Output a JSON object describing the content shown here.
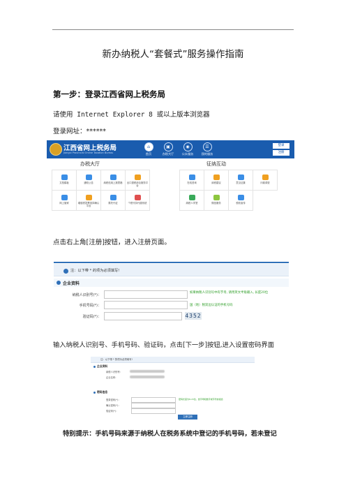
{
  "document": {
    "title": "新办纳税人“套餐式”服务操作指南",
    "step1_heading": "第一步：登录江西省网上税务局",
    "browser_note": "请使用 Internet Explorer 8 或以上版本浏览器",
    "url_label": "登录网址：******",
    "register_instruction": "点击右上角[注册]按钮，进入注册页面。",
    "input_instruction": "输入纳税人识别号、手机号码、验证码，点击[下一步]按钮,进入设置密码界面",
    "special_note": "特别提示：手机号码来源于纳税人在税务系统中登记的手机号码，若未登记"
  },
  "screenshot1": {
    "brand": "江西省网上税务局",
    "brand_sub": "Jiangxi Provincial Online Taxation Bureau",
    "nav": [
      {
        "label": "首页",
        "icon": "home-icon",
        "active": true
      },
      {
        "label": "办税大厅",
        "icon": "hall-icon",
        "active": false
      },
      {
        "label": "公众服务",
        "icon": "public-icon",
        "active": false
      },
      {
        "label": "我的服务",
        "icon": "service-icon",
        "active": false
      }
    ],
    "login_button": "登录",
    "register_button": "注册",
    "section_left": "办税大厅",
    "section_right": "征纳互动",
    "left_items": [
      {
        "label": "文档模板",
        "color": "#3a8ee6"
      },
      {
        "label": "通知公告",
        "color": "#3a8ee6"
      },
      {
        "label": "纳税信用上报表格",
        "color": "#3a8ee6"
      },
      {
        "label": "出口退税综合服务平台",
        "color": "#f0a020"
      },
      {
        "label": "网上管家",
        "color": "#3a8ee6"
      },
      {
        "label": "增值税发票选择确认平台",
        "color": "#f0a020"
      },
      {
        "label": "委托代征",
        "color": "#3a8ee6"
      },
      {
        "label": "个税代扣代缴系统",
        "color": "#e05050"
      }
    ],
    "right_items": [
      {
        "label": "在线咨询",
        "color": "#3a8ee6"
      },
      {
        "label": "纳税建议",
        "color": "#f0a020"
      },
      {
        "label": "意见征集",
        "color": "#3a8ee6"
      },
      {
        "label": "问卷调查",
        "color": "#f0a020"
      },
      {
        "label": "纳税人学堂",
        "color": "#3aaa5a"
      },
      {
        "label": "微信服务",
        "color": "#8dc63f"
      },
      {
        "label": "税收宣传",
        "color": "#3a8ee6"
      }
    ]
  },
  "screenshot2": {
    "note": "注：以下带 * 的项为必须填写!",
    "section": "企业资料",
    "fields": [
      {
        "label": "纳税人识别号(*)：",
        "hint": "如果纳税人识别号中有字母, 请用英文半角输入, 长度20位"
      },
      {
        "label": "手机号码(*)：",
        "hint": "国（地）税双边认证的手机号码"
      },
      {
        "label": "验证码(*)：",
        "hint": ""
      }
    ],
    "captcha": "4352"
  },
  "screenshot3": {
    "note": "注：以下带 * 的项为必须填写!",
    "section1": "企业资料",
    "section2": "密码信息",
    "info_fields": [
      {
        "label": "纳税人识别号："
      },
      {
        "label": "企业名称："
      }
    ],
    "pwd_fields": [
      {
        "label": "登录密码(*)：",
        "hint": "密码长度为8-15位，含字母和数字或字符的组合"
      },
      {
        "label": "确认密码(*)："
      },
      {
        "label": "验证码(*)："
      }
    ],
    "button": "立即注册"
  }
}
